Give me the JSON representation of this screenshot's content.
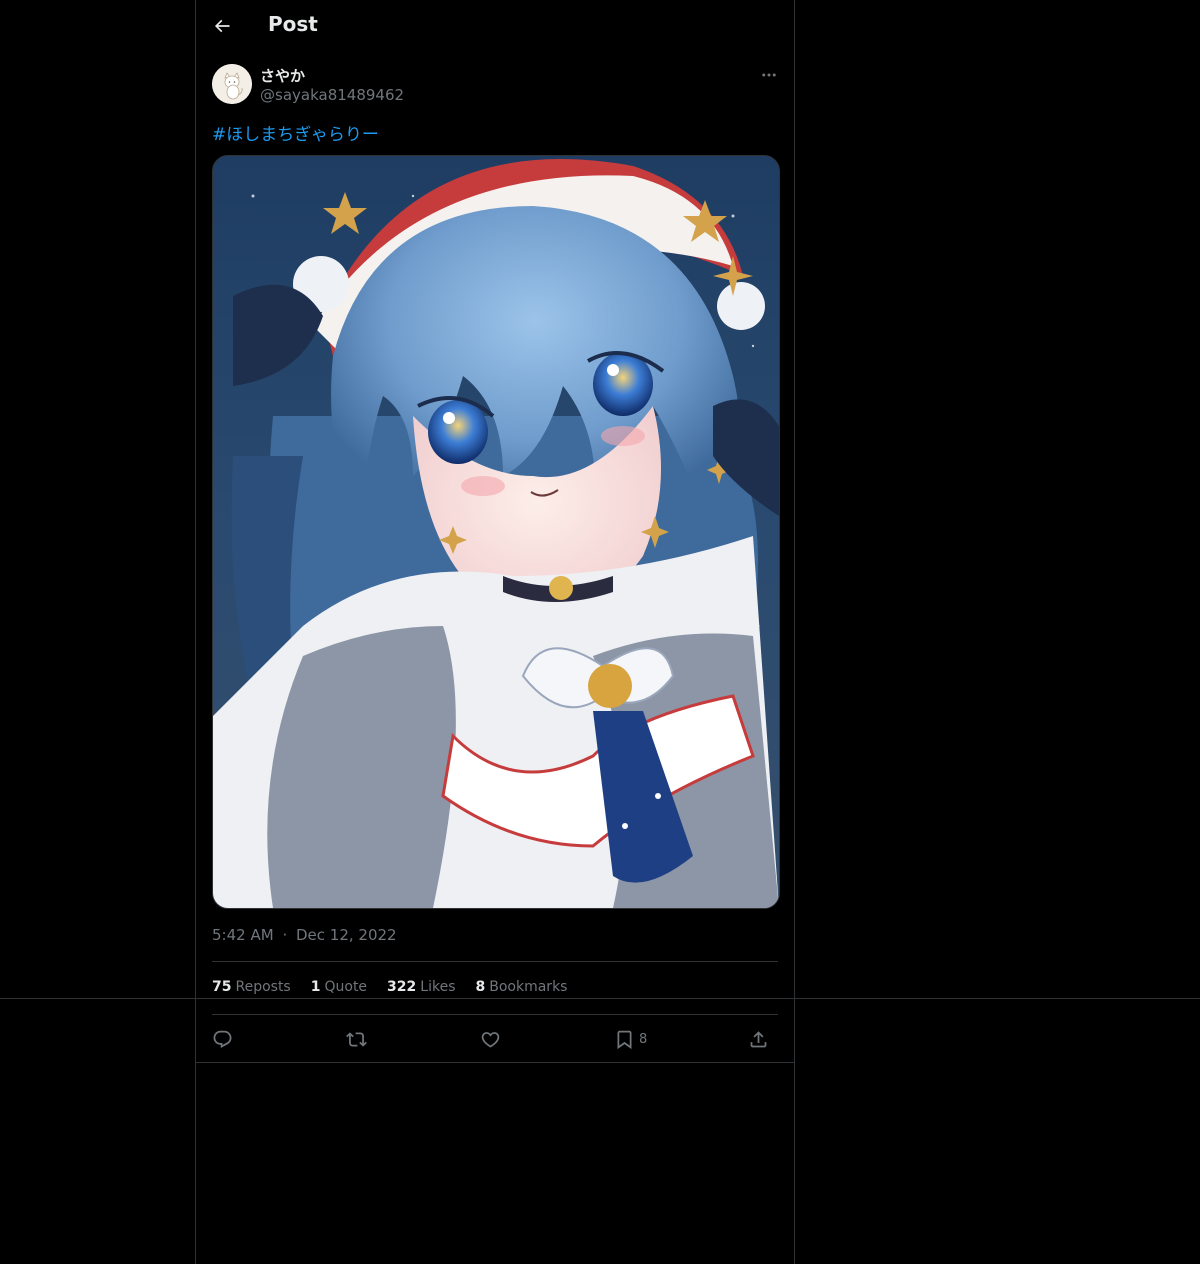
{
  "header": {
    "back_icon": "arrow-left-icon",
    "title": "Post"
  },
  "author": {
    "display_name": "さやか",
    "handle": "@sayaka81489462",
    "avatar_icon": "cat-avatar"
  },
  "post": {
    "hashtag": "#ほしまちぎゃらりー",
    "time": "5:42 AM",
    "separator": "·",
    "date": "Dec 12, 2022"
  },
  "stats": {
    "reposts_count": "75",
    "reposts_label": "Reposts",
    "quote_count": "1",
    "quote_label": "Quote",
    "likes_count": "322",
    "likes_label": "Likes",
    "bookmarks_count": "8",
    "bookmarks_label": "Bookmarks"
  },
  "actions": {
    "bookmark_count": "8"
  },
  "colors": {
    "background": "#000000",
    "border": "#2f3336",
    "text_primary": "#e7e9ea",
    "text_secondary": "#71767b",
    "link": "#1d9bf0"
  }
}
